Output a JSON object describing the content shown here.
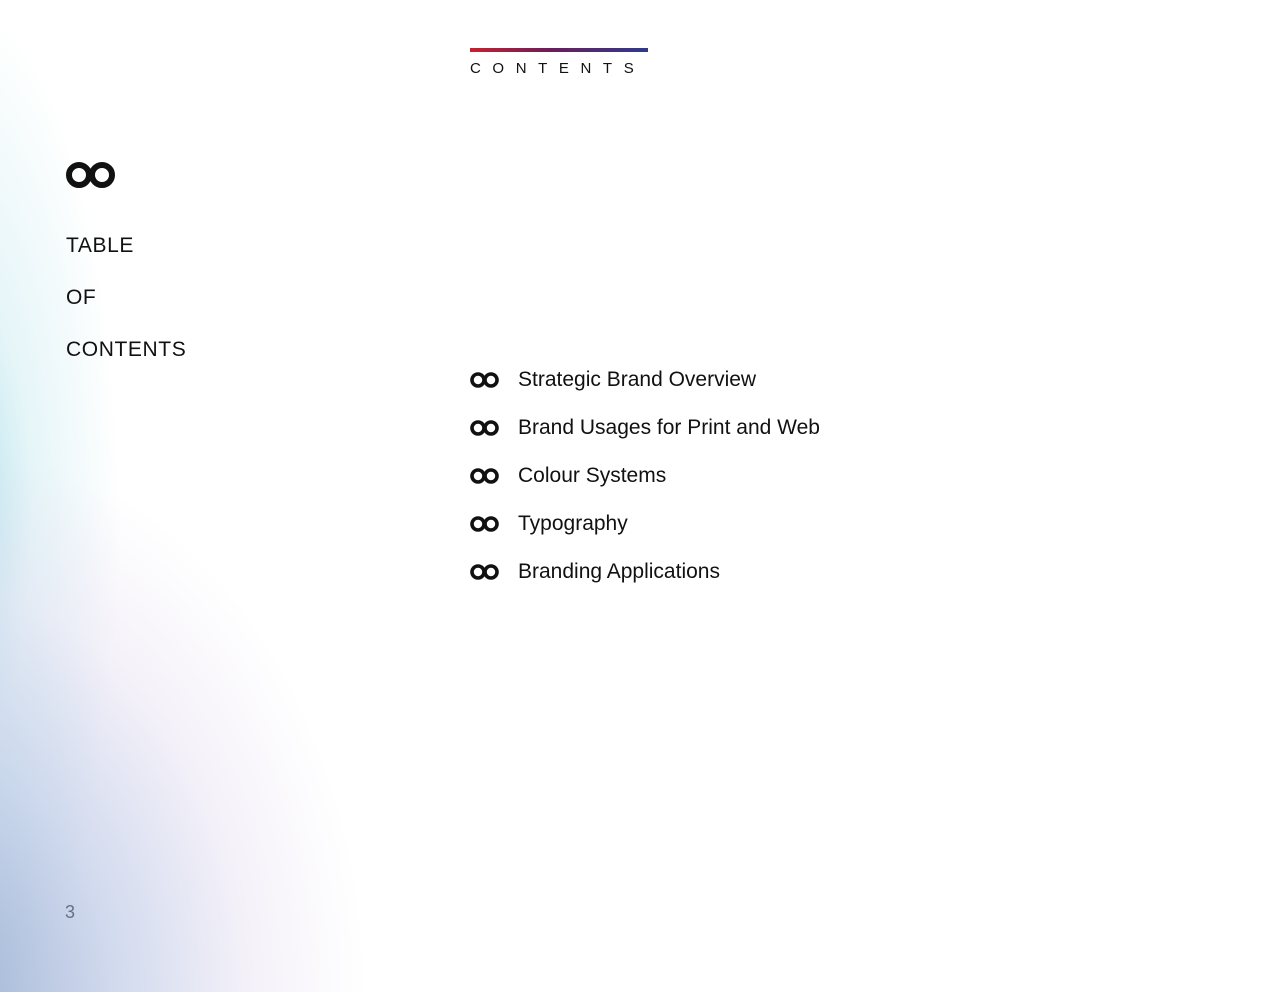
{
  "header": {
    "title": "CONTENTS"
  },
  "logo": {
    "icon": "infinity-loop-icon"
  },
  "side_title": {
    "lines": [
      "TABLE",
      "OF",
      "CONTENTS"
    ]
  },
  "toc": {
    "items": [
      {
        "label": "Strategic Brand Overview",
        "icon": "infinity-loop-icon"
      },
      {
        "label": "Brand Usages for Print and Web",
        "icon": "infinity-loop-icon"
      },
      {
        "label": "Colour Systems",
        "icon": "infinity-loop-icon"
      },
      {
        "label": "Typography",
        "icon": "infinity-loop-icon"
      },
      {
        "label": "Branding Applications",
        "icon": "infinity-loop-icon"
      }
    ]
  },
  "page_number": "3",
  "colors": {
    "accent_start": "#c8202e",
    "accent_end": "#2e3a8c",
    "text": "#111111"
  }
}
